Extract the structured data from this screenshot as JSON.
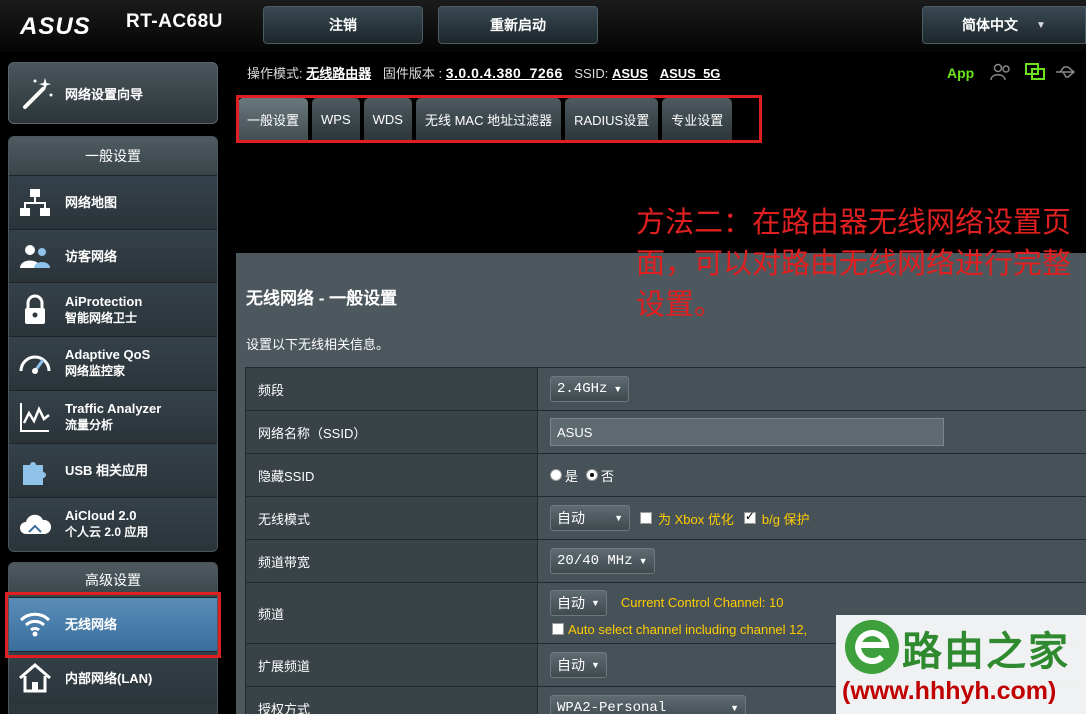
{
  "header": {
    "brand": "ASUS",
    "model": "RT-AC68U",
    "logout_label": "注销",
    "reboot_label": "重新启动",
    "language_label": "简体中文"
  },
  "status": {
    "mode_label": "操作模式:",
    "mode_value": "无线路由器",
    "firmware_label": "固件版本 :",
    "firmware_value": "3.0.0.4.380_7266",
    "ssid_label": "SSID:",
    "ssid_1": "ASUS",
    "ssid_2": "ASUS_5G",
    "app_label": "App"
  },
  "sidebar": {
    "wizard_label": "网络设置向导",
    "general_header": "一般设置",
    "general_items": [
      {
        "label": "网络地图",
        "sub": "",
        "icon": "network-map-icon"
      },
      {
        "label": "访客网络",
        "sub": "",
        "icon": "guest-network-icon"
      },
      {
        "label": "AiProtection",
        "sub": "智能网络卫士",
        "icon": "lock-icon"
      },
      {
        "label": "Adaptive QoS",
        "sub": "网络监控家",
        "icon": "speedometer-icon"
      },
      {
        "label": "Traffic Analyzer",
        "sub": "流量分析",
        "icon": "traffic-chart-icon"
      },
      {
        "label": "USB 相关应用",
        "sub": "",
        "icon": "puzzle-icon"
      },
      {
        "label": "AiCloud 2.0",
        "sub": "个人云 2.0 应用",
        "icon": "cloud-icon"
      }
    ],
    "advanced_header": "高级设置",
    "advanced_items": [
      {
        "label": "无线网络",
        "icon": "wifi-icon",
        "active": true
      },
      {
        "label": "内部网络(LAN)",
        "icon": "home-icon",
        "active": false
      }
    ]
  },
  "tabs": [
    "一般设置",
    "WPS",
    "WDS",
    "无线 MAC 地址过滤器",
    "RADIUS设置",
    "专业设置"
  ],
  "panel": {
    "title": "无线网络 - 一般设置",
    "description": "设置以下无线相关信息。",
    "rows": {
      "band": {
        "label": "频段",
        "value": "2.4GHz"
      },
      "ssid": {
        "label": "网络名称（SSID）",
        "value": "ASUS"
      },
      "hide_ssid": {
        "label": "隐藏SSID",
        "yes": "是",
        "no": "否"
      },
      "mode": {
        "label": "无线模式",
        "value": "自动",
        "xbox": "为 Xbox 优化",
        "bg": "b/g 保护"
      },
      "bandwidth": {
        "label": "频道带宽",
        "value": "20/40 MHz"
      },
      "channel": {
        "label": "频道",
        "value": "自动",
        "current": "Current Control Channel: 10",
        "auto": "Auto select channel including channel 12,"
      },
      "ext_channel": {
        "label": "扩展频道",
        "value": "自动"
      },
      "auth": {
        "label": "授权方式",
        "value": "WPA2-Personal"
      }
    }
  },
  "annotation": {
    "text": "方法二：在路由器无线网络设置页面，可以对路由无线网络进行完整设置。"
  },
  "watermark": {
    "name": "路由之家",
    "url": "(www.hhhyh.com)"
  },
  "colors": {
    "annotation": "#e02020",
    "active_menu": "#4a7fad",
    "app_green": "#6ce21c",
    "yellow_text": "#ffcc00"
  }
}
